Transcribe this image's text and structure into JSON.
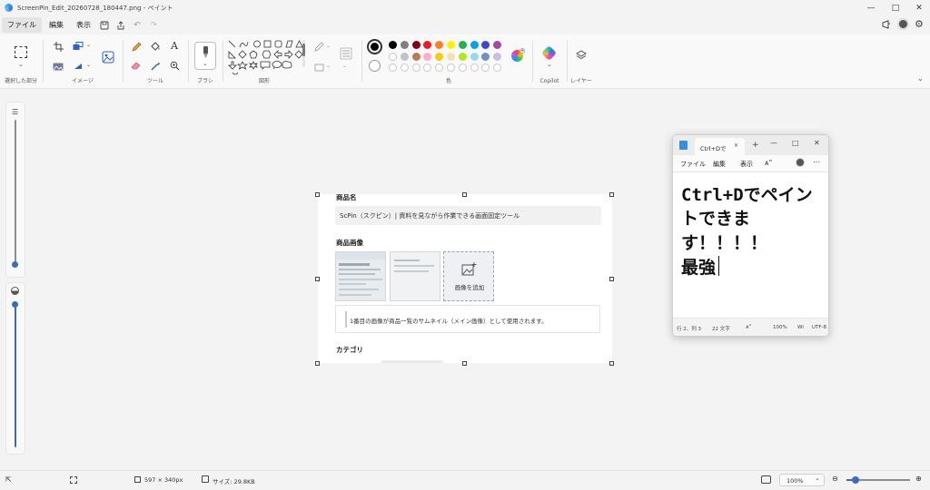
{
  "window": {
    "title": "ScreenPin_Edit_20260728_180447.png - ペイント"
  },
  "menu": {
    "items": [
      {
        "label": "ファイル"
      },
      {
        "label": "編集"
      },
      {
        "label": "表示"
      }
    ]
  },
  "ribbon": {
    "groups": {
      "selection": "選択した部分",
      "image": "イメージ",
      "tools": "ツール",
      "brushes": "ブラシ",
      "shapes": "図形",
      "colors": "色",
      "copilot": "Copilot",
      "layers": "レイヤー"
    },
    "text_tool_glyph": "A",
    "colors": {
      "primary": "#000000",
      "row1": [
        "#000000",
        "#7f7f7f",
        "#880015",
        "#ed1c24",
        "#ff7f27",
        "#fff200",
        "#22b14c",
        "#00a2e8",
        "#3f48cc",
        "#a349a4"
      ],
      "row2": [
        "#ffffff",
        "#c3c3c3",
        "#b97a57",
        "#ffaec9",
        "#ffc90e",
        "#efe4b0",
        "#b5e61d",
        "#99d9ea",
        "#7092be",
        "#c8bfe7"
      ]
    }
  },
  "canvas_content": {
    "product_name_label": "商品名",
    "product_name_value": "ScPin（スクピン）| 資料を見ながら作業できる画面固定ツール",
    "product_image_label": "商品画像",
    "add_image_label": "画像を追加",
    "note": "1番目の画像が商品一覧のサムネイル（メイン画像）として使用されます。",
    "category_label": "カテゴリ"
  },
  "notepad": {
    "tab_title": "Ctrl+Dで",
    "menu": [
      "ファイル",
      "編集",
      "表示"
    ],
    "lines": [
      "Ctrl+Dでペイン",
      "トできま",
      "す！！！！",
      "最強"
    ],
    "status": {
      "position": "行 2、列 3",
      "chars": "22 文字",
      "zoom": "100%",
      "line_ending": "Wi",
      "encoding": "UTF-8"
    }
  },
  "statusbar": {
    "dimensions": "597 × 340px",
    "size": "サイズ: 29.8KB",
    "zoom": "100%"
  }
}
